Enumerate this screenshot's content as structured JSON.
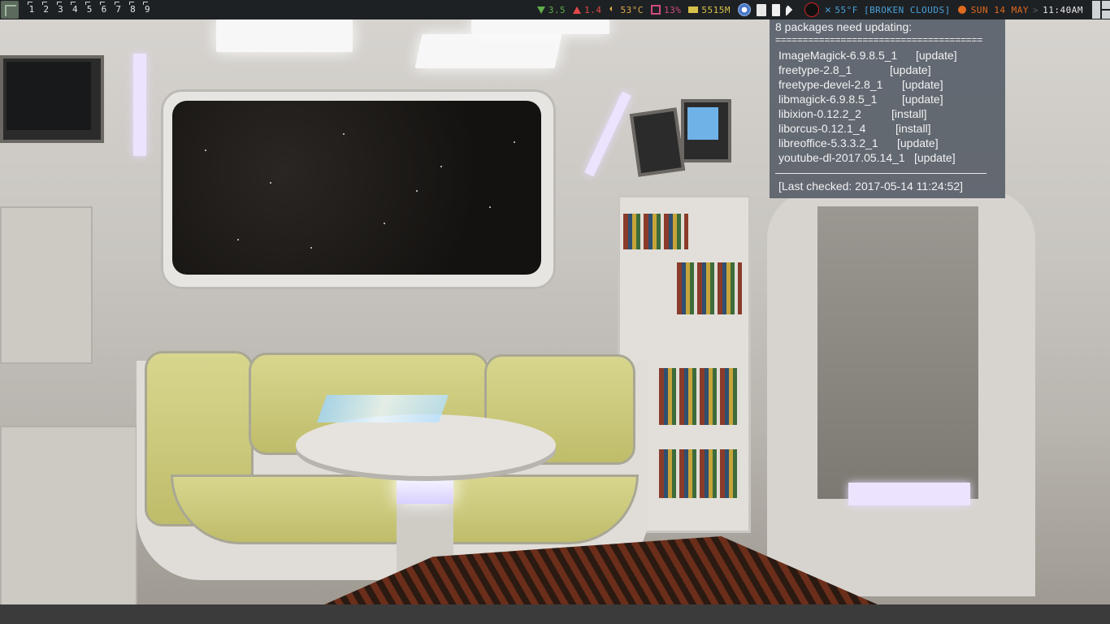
{
  "topbar": {
    "workspaces": [
      "1",
      "2",
      "3",
      "4",
      "5",
      "6",
      "7",
      "8",
      "9"
    ],
    "net_down": "3.5",
    "net_up": "1.4",
    "temperature": "53°C",
    "cpu": "13%",
    "memory": "5515M",
    "weather": "55°F [BROKEN CLOUDS]",
    "date": "SUN 14 MAY",
    "separator": ">",
    "time": "11:40AM",
    "colors": {
      "net_down": "#5fae48",
      "net_up": "#e34848",
      "temperature": "#e0a94b",
      "cpu": "#d04b7a",
      "memory": "#d8c14a",
      "weather": "#4ba0d9",
      "date": "#e06a20"
    },
    "tray_icons": [
      "chrome-icon",
      "clipboard-icon",
      "battery-icon",
      "wifi-icon",
      "cat-avatar-icon"
    ]
  },
  "update_popup": {
    "title": "8 packages need updating:",
    "rule": "======================================",
    "packages": [
      {
        "name": "ImageMagick-6.9.8.5_1",
        "status": "[update]"
      },
      {
        "name": "freetype-2.8_1",
        "status": "[update]"
      },
      {
        "name": "freetype-devel-2.8_1",
        "status": "[update]"
      },
      {
        "name": "libmagick-6.9.8.5_1",
        "status": "[update]"
      },
      {
        "name": "libixion-0.12.2_2",
        "status": "[install]"
      },
      {
        "name": "liborcus-0.12.1_4",
        "status": "[install]"
      },
      {
        "name": "libreoffice-5.3.3.2_1",
        "status": "[update]"
      },
      {
        "name": "youtube-dl-2017.05.14_1",
        "status": "[update]"
      }
    ],
    "footer": "[Last checked: 2017-05-14 11:24:52]"
  }
}
